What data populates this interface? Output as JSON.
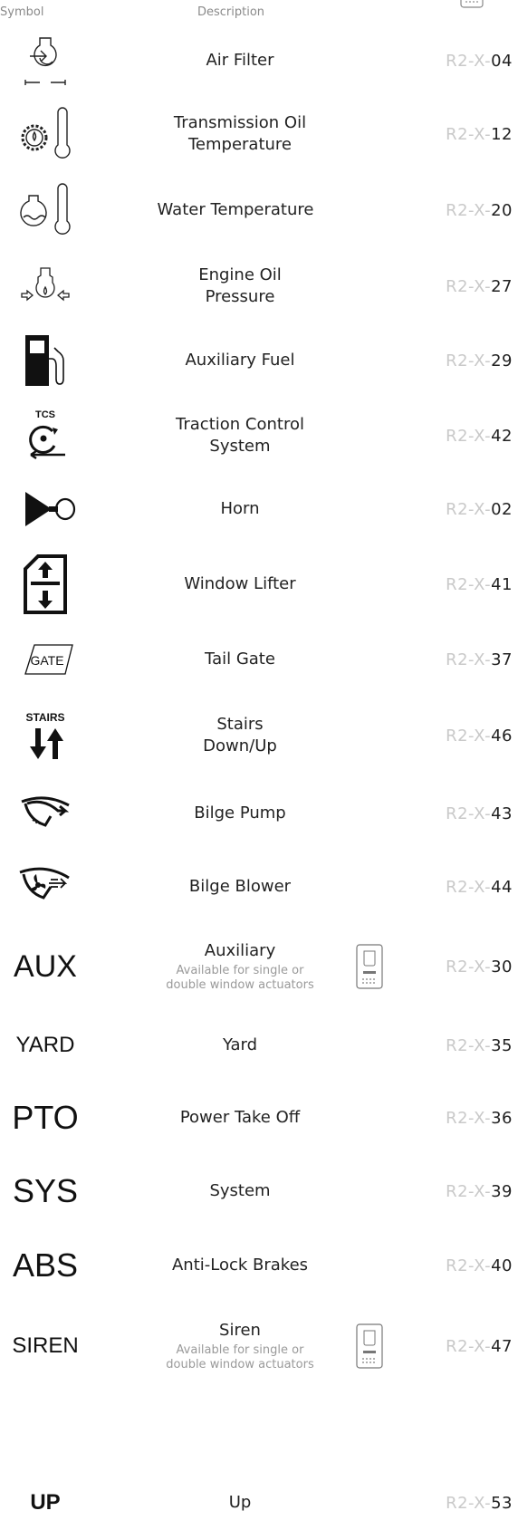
{
  "header": {
    "symbol": "Symbol",
    "description": "Description"
  },
  "rows": [
    {
      "description": "Air Filter",
      "code_prefix": "R2-X-",
      "code_number": "04",
      "icon": "air-filter-icon"
    },
    {
      "description": "Transmission Oil\nTemperature",
      "code_prefix": "R2-X-",
      "code_number": "12",
      "icon": "transmission-oil-temperature-icon"
    },
    {
      "description": "Water Temperature",
      "code_prefix": "R2-X-",
      "code_number": "20",
      "icon": "water-temperature-icon"
    },
    {
      "description": "Engine Oil\nPressure",
      "code_prefix": "R2-X-",
      "code_number": "27",
      "icon": "engine-oil-pressure-icon"
    },
    {
      "description": "Auxiliary Fuel",
      "code_prefix": "R2-X-",
      "code_number": "29",
      "icon": "fuel-pump-icon"
    },
    {
      "description": "Traction Control\nSystem",
      "code_prefix": "R2-X-",
      "code_number": "42",
      "icon": "traction-control-icon",
      "icon_label": "TCS"
    },
    {
      "description": "Horn",
      "code_prefix": "R2-X-",
      "code_number": "02",
      "icon": "horn-icon"
    },
    {
      "description": "Window Lifter",
      "code_prefix": "R2-X-",
      "code_number": "41",
      "icon": "window-lifter-icon"
    },
    {
      "description": "Tail Gate",
      "code_prefix": "R2-X-",
      "code_number": "37",
      "icon": "tail-gate-icon",
      "icon_label": "GATE"
    },
    {
      "description": "Stairs\nDown/Up",
      "code_prefix": "R2-X-",
      "code_number": "46",
      "icon": "stairs-icon",
      "icon_label": "STAIRS"
    },
    {
      "description": "Bilge Pump",
      "code_prefix": "R2-X-",
      "code_number": "43",
      "icon": "bilge-pump-icon"
    },
    {
      "description": "Bilge Blower",
      "code_prefix": "R2-X-",
      "code_number": "44",
      "icon": "bilge-blower-icon"
    },
    {
      "symbol_text": "AUX",
      "description": "Auxiliary",
      "note": "Available for single or\ndouble window actuators",
      "code_prefix": "R2-X-",
      "code_number": "30"
    },
    {
      "symbol_text": "YARD",
      "description": "Yard",
      "code_prefix": "R2-X-",
      "code_number": "35"
    },
    {
      "symbol_text": "PTO",
      "description": "Power Take Off",
      "code_prefix": "R2-X-",
      "code_number": "36"
    },
    {
      "symbol_text": "SYS",
      "description": "System",
      "code_prefix": "R2-X-",
      "code_number": "39"
    },
    {
      "symbol_text": "ABS",
      "description": "Anti-Lock Brakes",
      "code_prefix": "R2-X-",
      "code_number": "40"
    },
    {
      "symbol_text": "SIREN",
      "description": "Siren",
      "note": "Available for single or\ndouble window actuators",
      "code_prefix": "R2-X-",
      "code_number": "47"
    },
    {
      "symbol_text": "UP",
      "description": "Up",
      "code_prefix": "R2-X-",
      "code_number": "53"
    }
  ]
}
